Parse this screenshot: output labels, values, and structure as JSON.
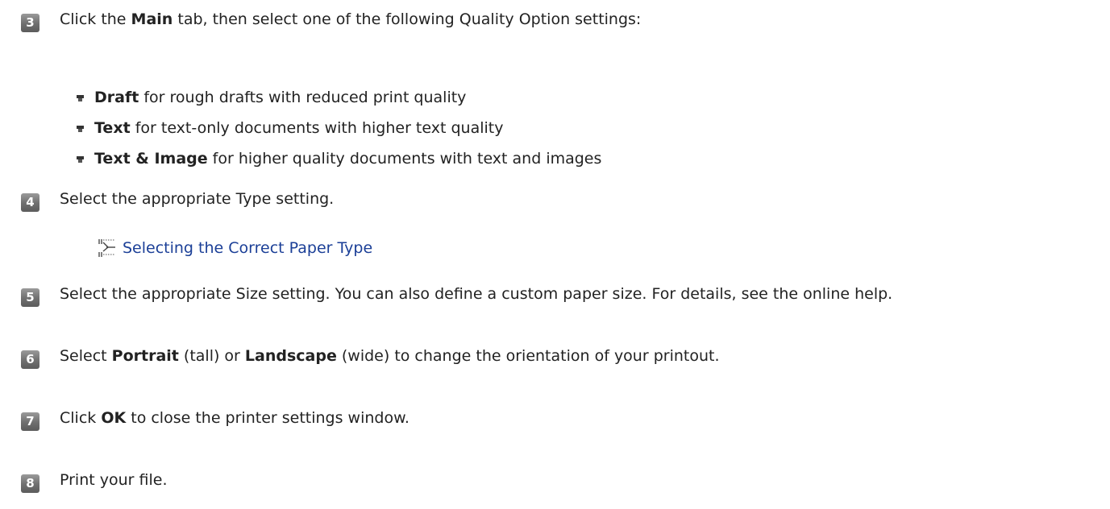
{
  "steps": [
    {
      "number": "3",
      "parts": [
        {
          "text": "Click the ",
          "bold": false
        },
        {
          "text": "Main",
          "bold": true
        },
        {
          "text": " tab, then select one of the following Quality Option settings:",
          "bold": false
        }
      ]
    },
    {
      "number": "4",
      "parts": [
        {
          "text": "Select the appropriate Type setting.",
          "bold": false
        }
      ]
    },
    {
      "number": "5",
      "parts": [
        {
          "text": "Select the appropriate Size setting. You can also define a custom paper size. For details, see the online help.",
          "bold": false
        }
      ]
    },
    {
      "number": "6",
      "parts": [
        {
          "text": "Select ",
          "bold": false
        },
        {
          "text": "Portrait",
          "bold": true
        },
        {
          "text": " (tall) or ",
          "bold": false
        },
        {
          "text": "Landscape",
          "bold": true
        },
        {
          "text": " (wide) to change the orientation of your printout.",
          "bold": false
        }
      ]
    },
    {
      "number": "7",
      "parts": [
        {
          "text": "Click ",
          "bold": false
        },
        {
          "text": "OK",
          "bold": true
        },
        {
          "text": " to close the printer settings window.",
          "bold": false
        }
      ]
    },
    {
      "number": "8",
      "parts": [
        {
          "text": "Print your file.",
          "bold": false
        }
      ]
    }
  ],
  "quality_options": [
    {
      "label": "Draft",
      "description": " for rough drafts with reduced print quality"
    },
    {
      "label": "Text",
      "description": " for text-only documents with higher text quality"
    },
    {
      "label": "Text & Image",
      "description": " for higher quality documents with text and images"
    }
  ],
  "related_link": {
    "icon": "cross-reference-icon",
    "text": "Selecting the Correct Paper Type"
  },
  "colors": {
    "badge": "#6f6f6f",
    "link": "#1b3f97",
    "text": "#222222"
  }
}
